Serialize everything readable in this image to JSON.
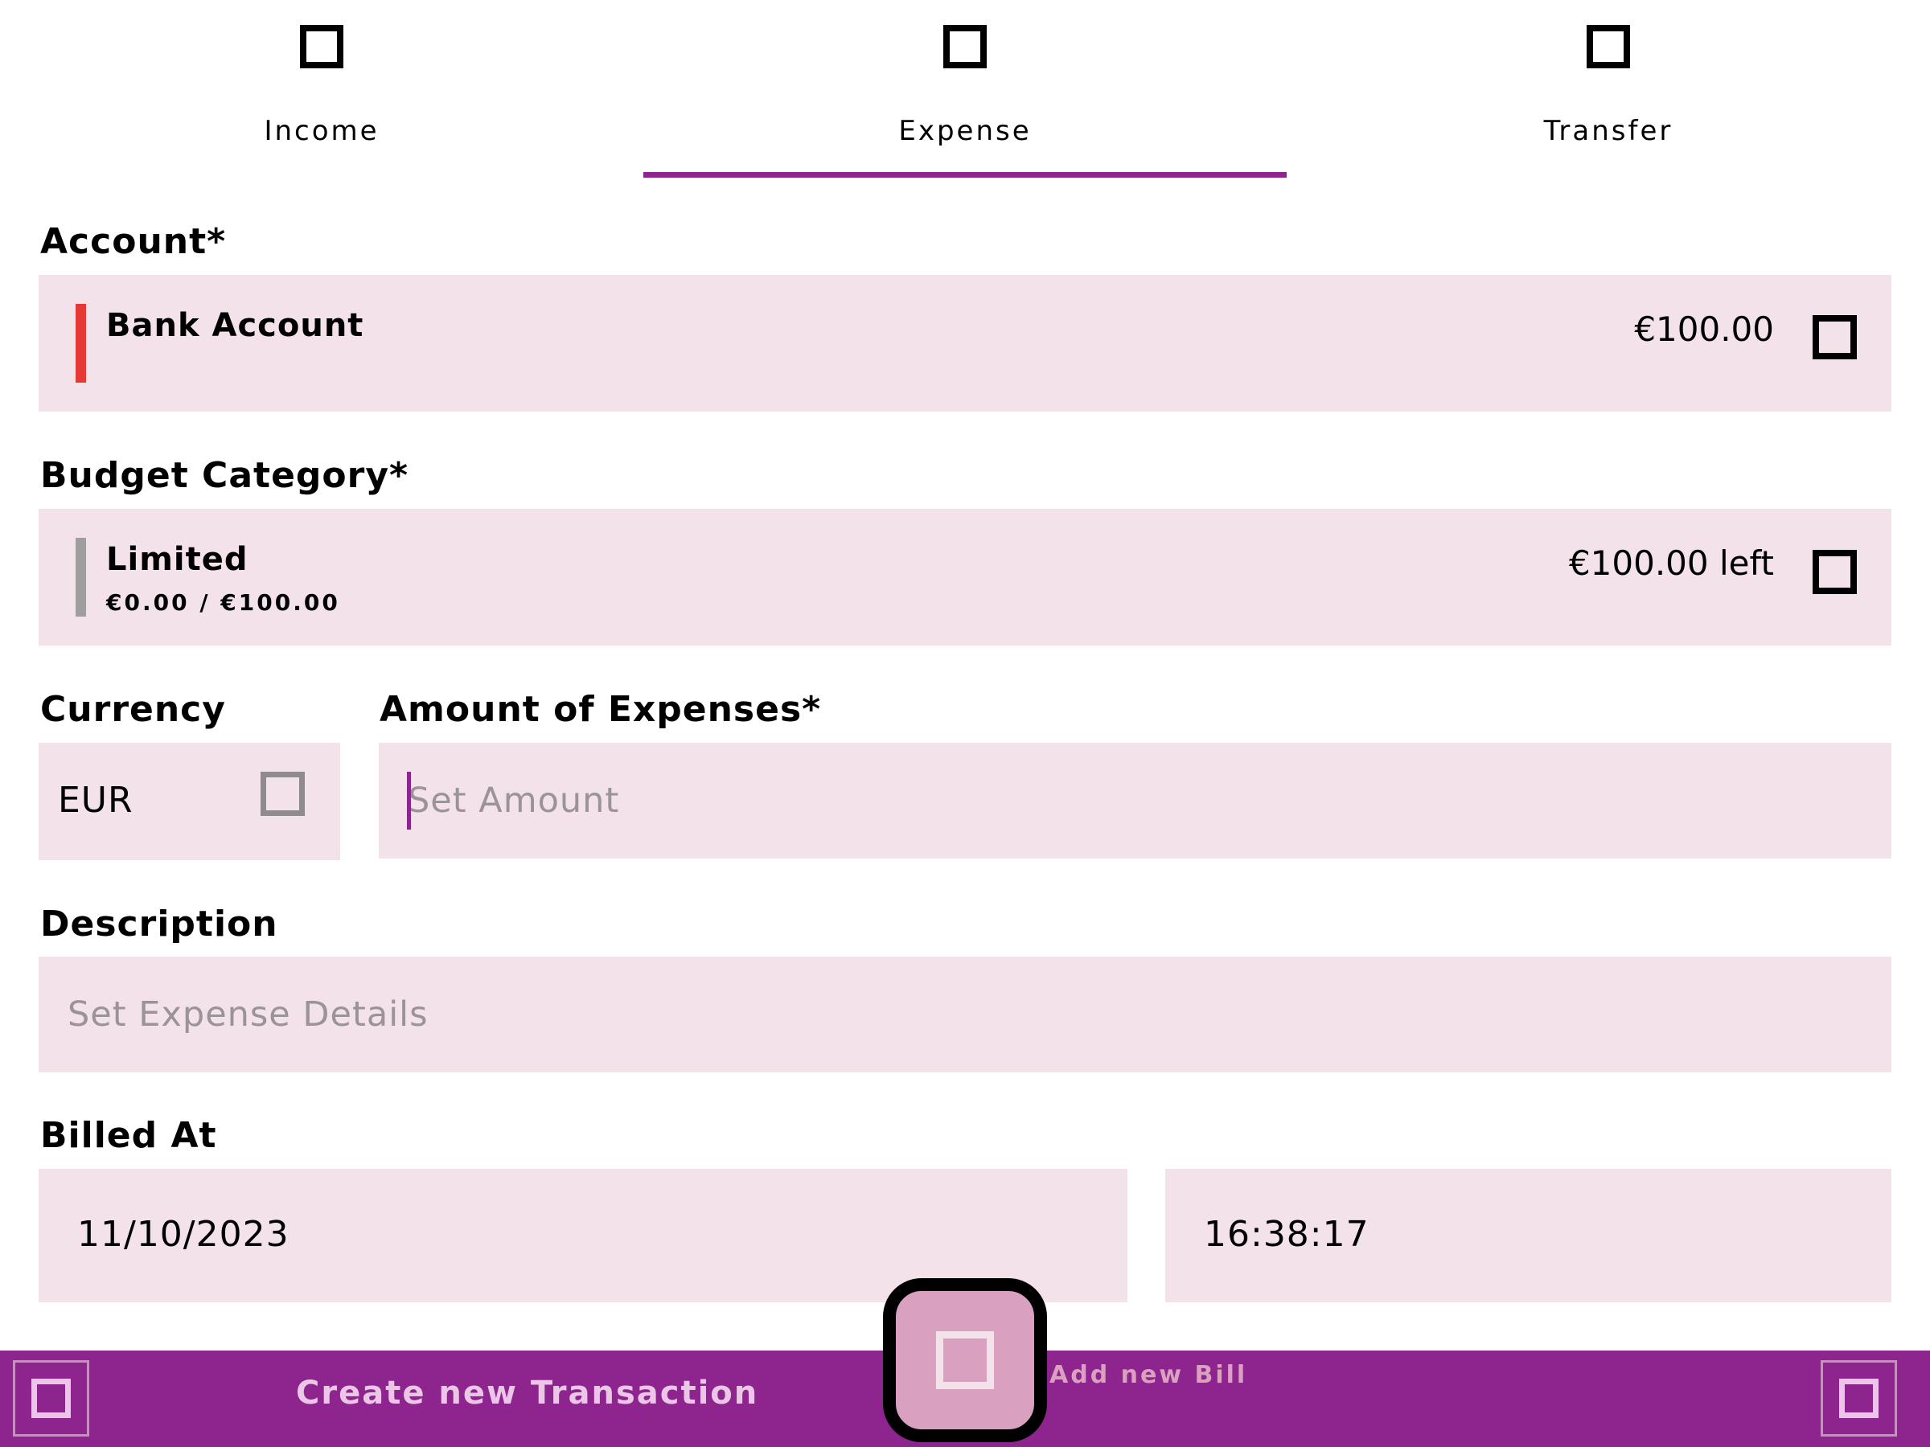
{
  "tabs": [
    {
      "label": "Income",
      "icon": "square-icon",
      "active": false
    },
    {
      "label": "Expense",
      "icon": "square-icon",
      "active": true
    },
    {
      "label": "Transfer",
      "icon": "square-icon",
      "active": false
    }
  ],
  "account": {
    "label": "Account*",
    "name": "Bank Account",
    "balance": "€100.00",
    "marker_color": "#e53935",
    "icon": "square-icon"
  },
  "budget": {
    "label": "Budget Category*",
    "name": "Limited",
    "usage": "€0.00 / €100.00",
    "remaining": "€100.00 left",
    "marker_color": "#9e9e9e",
    "icon": "square-icon"
  },
  "currency": {
    "label": "Currency",
    "value": "EUR",
    "icon": "square-icon"
  },
  "amount": {
    "label": "Amount of Expenses*",
    "value": "",
    "placeholder": "Set Amount"
  },
  "description": {
    "label": "Description",
    "value": "",
    "placeholder": "Set Expense Details"
  },
  "billed_at": {
    "label": "Billed At",
    "date": "11/10/2023",
    "time": "16:38:17"
  },
  "bottom_bar": {
    "create_label": "Create new Transaction",
    "add_bill_label": "Add new Bill",
    "left_icon": "square-icon",
    "right_icon": "square-icon",
    "fab_icon": "square-icon"
  },
  "colors": {
    "accent": "#8e248d",
    "field_bg": "#f3e2ea",
    "fab": "#d9a1bf"
  }
}
